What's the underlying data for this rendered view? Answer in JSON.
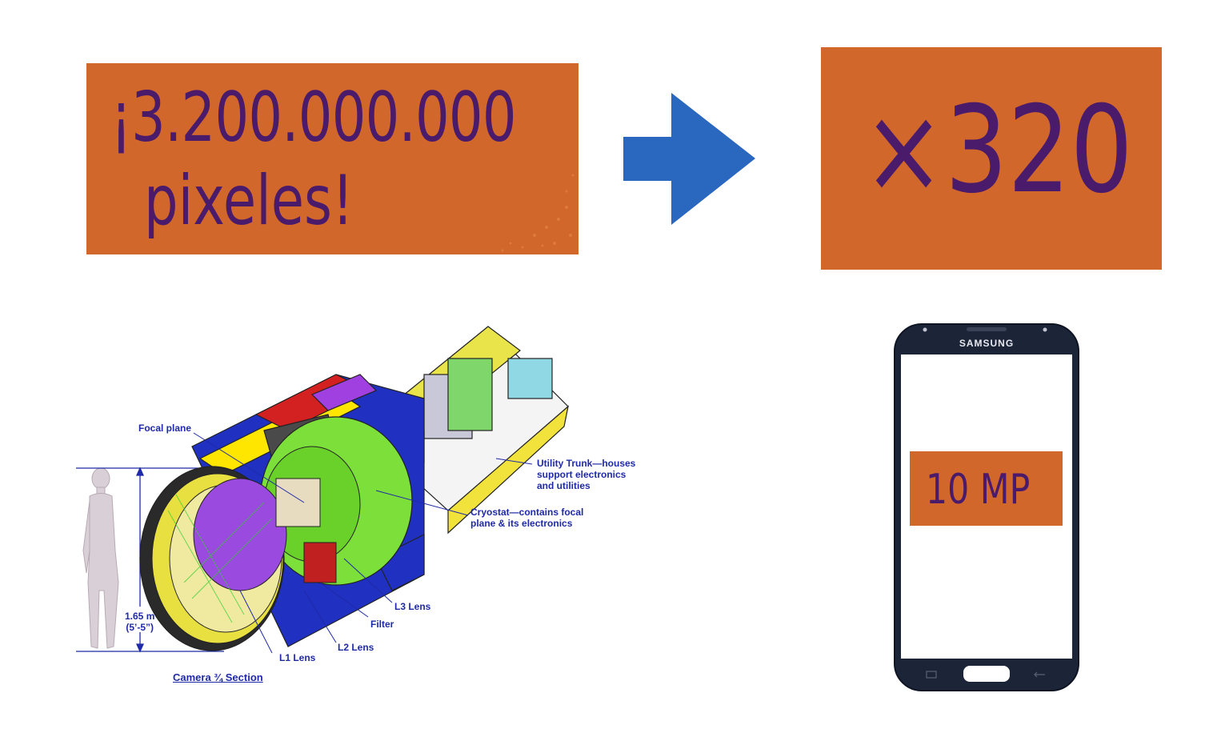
{
  "headline": {
    "line1": "¡3.200.000.000",
    "line2": "pixeles!"
  },
  "multiplier": "×320",
  "camera": {
    "labels": {
      "focal_plane": "Focal plane",
      "utility_trunk": "Utility Trunk—houses\nsupport electronics\nand utilities",
      "cryostat": "Cryostat—contains focal\nplane & its electronics",
      "height": "1.65 m\n(5’-5”)",
      "l3": "L3 Lens",
      "filter": "Filter",
      "l2": "L2 Lens",
      "l1": "L1 Lens"
    },
    "caption": "Camera ¾ Section"
  },
  "phone": {
    "brand": "SAMSUNG",
    "megapixels": "10 MP"
  },
  "colors": {
    "box_orange": "#d2672b",
    "text_purple": "#4a1a6b",
    "arrow_blue": "#2a67be",
    "label_blue": "#1f2aa8"
  }
}
